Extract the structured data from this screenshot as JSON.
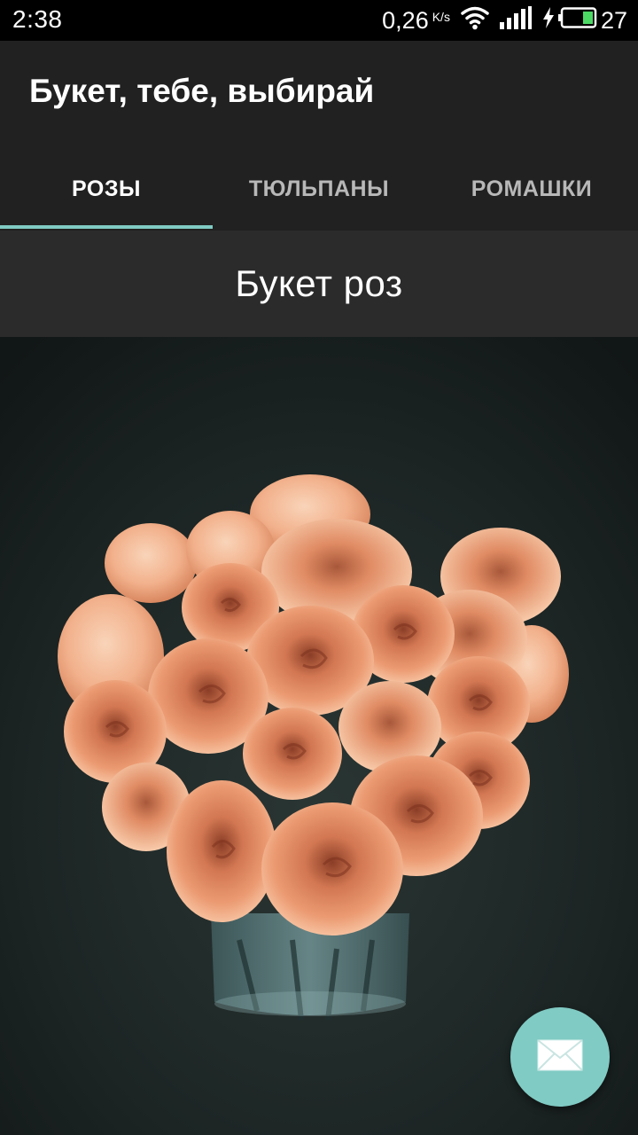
{
  "status_bar": {
    "time": "2:38",
    "net_speed": "0,26",
    "net_unit": "K/s",
    "battery_level": "27",
    "icons": [
      "wifi-icon",
      "signal-icon",
      "charging-icon",
      "battery-icon"
    ]
  },
  "app_bar": {
    "title": "Букет, тебе, выбирай"
  },
  "tabs": [
    {
      "label": "РОЗЫ",
      "selected": true
    },
    {
      "label": "ТЮЛЬПАНЫ",
      "selected": false
    },
    {
      "label": "РОМАШКИ",
      "selected": false
    }
  ],
  "section": {
    "title": "Букет роз"
  },
  "fab": {
    "icon": "mail-icon"
  },
  "colors": {
    "status_bar_bg": "#000000",
    "app_bar_bg": "#212121",
    "section_bg": "#2b2b2b",
    "accent": "#80cbc4",
    "tab_active_text": "#ffffff",
    "tab_inactive_text": "#b8b8b8",
    "photo_bg": "#1f2524",
    "flower_peach": "#e8936a"
  }
}
